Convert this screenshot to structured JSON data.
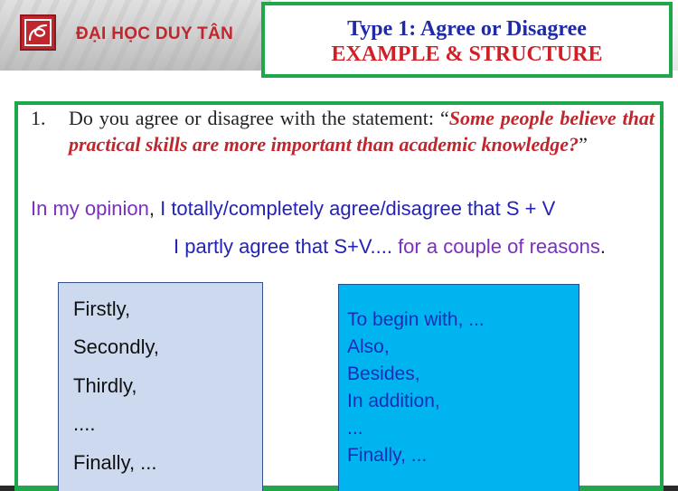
{
  "header": {
    "university_name": "ĐẠI HỌC DUY TÂN",
    "title_line1": "Type 1: Agree or Disagree",
    "title_line2": "EXAMPLE & STRUCTURE"
  },
  "question": {
    "number": "1.",
    "prefix": "Do you agree or disagree with the statement: “",
    "quote": "Some people believe that practical skills are more important than academic knowledge?",
    "suffix": "”"
  },
  "opinion": {
    "intro": "In my opinion",
    "comma": ",",
    "statement": " I totally/completely agree/disagree that S + V"
  },
  "partly": {
    "statement": "I partly agree that S+V.... ",
    "reasons": "for a couple of reasons",
    "period": "."
  },
  "ordinal_connectors": [
    "Firstly,",
    "Secondly,",
    "Thirdly,",
    "....",
    "Finally, ..."
  ],
  "additive_connectors": [
    "To begin with, ...",
    "Also,",
    "Besides,",
    "In addition,",
    "...",
    "Finally, ..."
  ],
  "colors": {
    "green_frame": "#1fa84a",
    "title_blue": "#1f2aa8",
    "accent_red": "#c0262d",
    "opinion_purple": "#7b2fbe",
    "statement_navy": "#2323b8",
    "left_box_fill": "#cdd9ee",
    "right_box_fill": "#00b4ef"
  }
}
